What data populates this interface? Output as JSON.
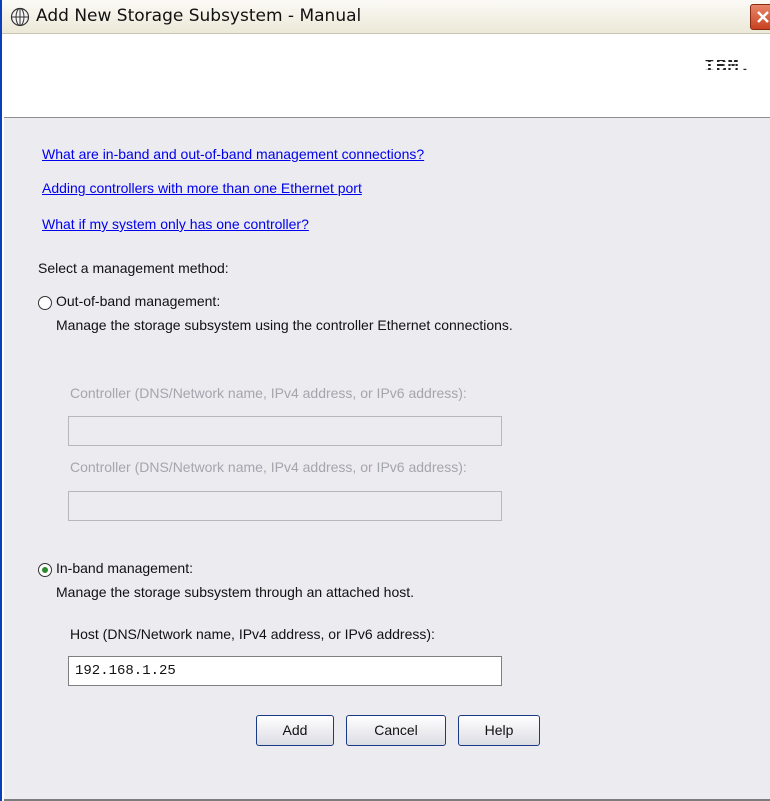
{
  "window": {
    "title": "Add New Storage Subsystem - Manual",
    "brand": "IBM."
  },
  "links": [
    "What are in-band and out-of-band management connections?",
    "Adding controllers with more than one Ethernet port",
    "What if my system only has one controller?"
  ],
  "form": {
    "prompt": "Select a management method:",
    "out_of_band": {
      "label": "Out-of-band management:",
      "description": "Manage the storage subsystem using the controller Ethernet connections.",
      "selected": false,
      "controller1_label": "Controller (DNS/Network name, IPv4 address, or IPv6 address):",
      "controller1_value": "",
      "controller2_label": "Controller (DNS/Network name, IPv4 address, or IPv6 address):",
      "controller2_value": ""
    },
    "in_band": {
      "label": "In-band management:",
      "description": "Manage the storage subsystem through an attached host.",
      "selected": true,
      "host_label": "Host (DNS/Network name, IPv4 address, or IPv6 address):",
      "host_value": "192.168.1.25"
    }
  },
  "buttons": {
    "add": "Add",
    "cancel": "Cancel",
    "help": "Help"
  },
  "icons": {
    "title": "globe-icon",
    "close": "close-icon"
  }
}
